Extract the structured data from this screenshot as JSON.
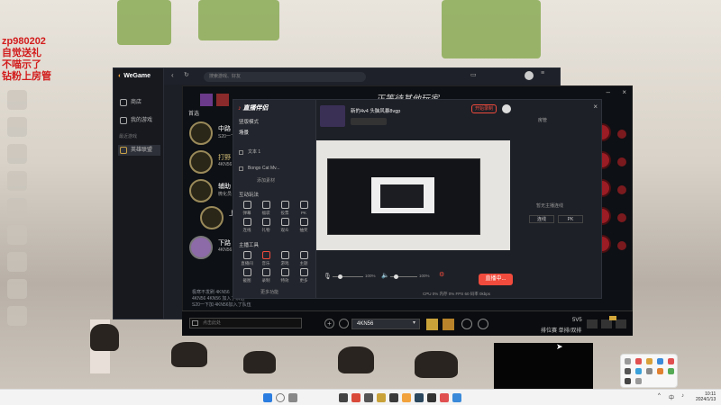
{
  "overlay_text": [
    "zp980202",
    "自觉送礼",
    "不喵示了",
    "钻粉上房管"
  ],
  "wegame": {
    "logo": "WeGame",
    "search_placeholder": "搜索游戏、好友",
    "nav": [
      {
        "label": "商店",
        "icon": "store-icon"
      },
      {
        "label": "我的游戏",
        "icon": "games-icon"
      }
    ],
    "section": "最近游戏",
    "game_item": "英雄联盟"
  },
  "game": {
    "title": "正等待其他玩家",
    "tab": "首选",
    "roles": [
      {
        "name": "中路",
        "sub": "S20一下"
      },
      {
        "name": "打野",
        "sub": "4KN56"
      },
      {
        "name": "辅助",
        "sub": "微化员"
      },
      {
        "name": "上",
        "sub": ""
      },
      {
        "name": "下路",
        "sub": "4KN56"
      }
    ],
    "chat_lines": [
      "极寒不发刷 4KN56",
      "4KN56 4KN56 加入了队伍",
      "S20一下加 4KN56加入了队伍"
    ],
    "chat_placeholder": "点击此处",
    "player_name": "4KN56",
    "mode": "5V5",
    "queue": "排位赛 单排/双排"
  },
  "helper": {
    "logo": "直播伴侣",
    "mode_label": "竖版模式",
    "tab1": "场景",
    "scenes": [
      "文本 1",
      "Bongo Cat Mv...",
      "添加素材"
    ],
    "sec_interact": "互动玩法",
    "sec_tools": "主播工具",
    "interact_tools": [
      "弹幕",
      "福袋",
      "投票",
      "PK",
      "连线",
      "礼物",
      "观众",
      "抽奖"
    ],
    "anchor_tools": [
      "直播间",
      "音乐",
      "游戏",
      "主题",
      "截图",
      "录制",
      "特效",
      "更多"
    ],
    "more": "更多功能",
    "stream_title": "新的4v4 头脑风暴8vgp",
    "record_label": "开始录制",
    "user_handle": "房管",
    "live_button": "直播中...",
    "vol_mic": "100%",
    "vol_speaker": "100%",
    "status_bar": "CPU 0%  内存 0%  FPS 60  码率 0kbps",
    "right_tip": "暂无主播连线",
    "right_btn1": "连线",
    "right_btn2": "PK"
  },
  "taskbar": {
    "time": "10:11",
    "date": "2024/1/13",
    "lang": "中"
  }
}
